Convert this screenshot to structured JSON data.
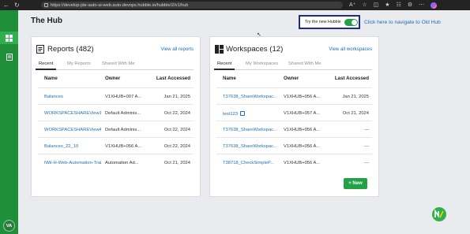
{
  "browser": {
    "url": "https://develop-jde-auto-ui-web.auto.devops.hubble.io/hubble/2/v1/hub"
  },
  "sidebar": {
    "items": [
      {
        "icon": "dashboard-icon",
        "active": true
      },
      {
        "icon": "document-icon",
        "active": false
      }
    ],
    "avatar_initials": "VA"
  },
  "header": {
    "title": "The Hub",
    "toggle_label": "Try the new Hubble",
    "toggle_on": true,
    "old_hub_link": "Click here to navigate to Old Hub"
  },
  "reports": {
    "title": "Reports (482)",
    "view_all": "View all reports",
    "tabs": [
      "Recent",
      "My Reports",
      "Shared With Me"
    ],
    "active_tab": 0,
    "columns": [
      "Name",
      "Owner",
      "Last Accessed"
    ],
    "rows": [
      {
        "name": "Balances",
        "owner": "V1XHUB+007 A...",
        "date": "Jan 21, 2025"
      },
      {
        "name": "WORKSPACESHAREView1",
        "owner": "Default Adminis...",
        "date": "Oct 22, 2024"
      },
      {
        "name": "WORKSPACESHAREView4",
        "owner": "Default Adminis...",
        "date": "Oct 22, 2024"
      },
      {
        "name": "Balances_22_10",
        "owner": "V1XHUB+056 A...",
        "date": "Oct 22, 2024"
      },
      {
        "name": "NW-H-Web-Automation-Trai",
        "owner": "Automation Ad...",
        "date": "Oct 21, 2024"
      }
    ]
  },
  "workspaces": {
    "title": "Workspaces (12)",
    "view_all": "View all workspaces",
    "tabs": [
      "Recent",
      "My Workspaces",
      "Shared With Me"
    ],
    "active_tab": 0,
    "columns": [
      "Name",
      "Owner",
      "Last Accessed"
    ],
    "rows": [
      {
        "name": "T37638_ShareWorkspac...",
        "owner": "V1XHUB+056 A...",
        "date": "Jan 21, 2025",
        "shared": false
      },
      {
        "name": "test123",
        "owner": "V1XHUB+057 A...",
        "date": "Oct 21, 2024",
        "shared": true
      },
      {
        "name": "T37638_ShareWorkspac...",
        "owner": "V1XHUB+056 A...",
        "date": "---",
        "shared": false
      },
      {
        "name": "T37638_ShareWorkspac...",
        "owner": "V1XHUB+056 A...",
        "date": "---",
        "shared": false
      },
      {
        "name": "T38718_CheckSimpleP...",
        "owner": "V1XHUB+056 A...",
        "date": "---",
        "shared": false
      }
    ],
    "new_button": "+ New"
  },
  "colors": {
    "accent": "#24a148",
    "sidebar": "#1f8f3a",
    "link": "#1f6fb4",
    "highlight_border": "#1f2a8a"
  }
}
